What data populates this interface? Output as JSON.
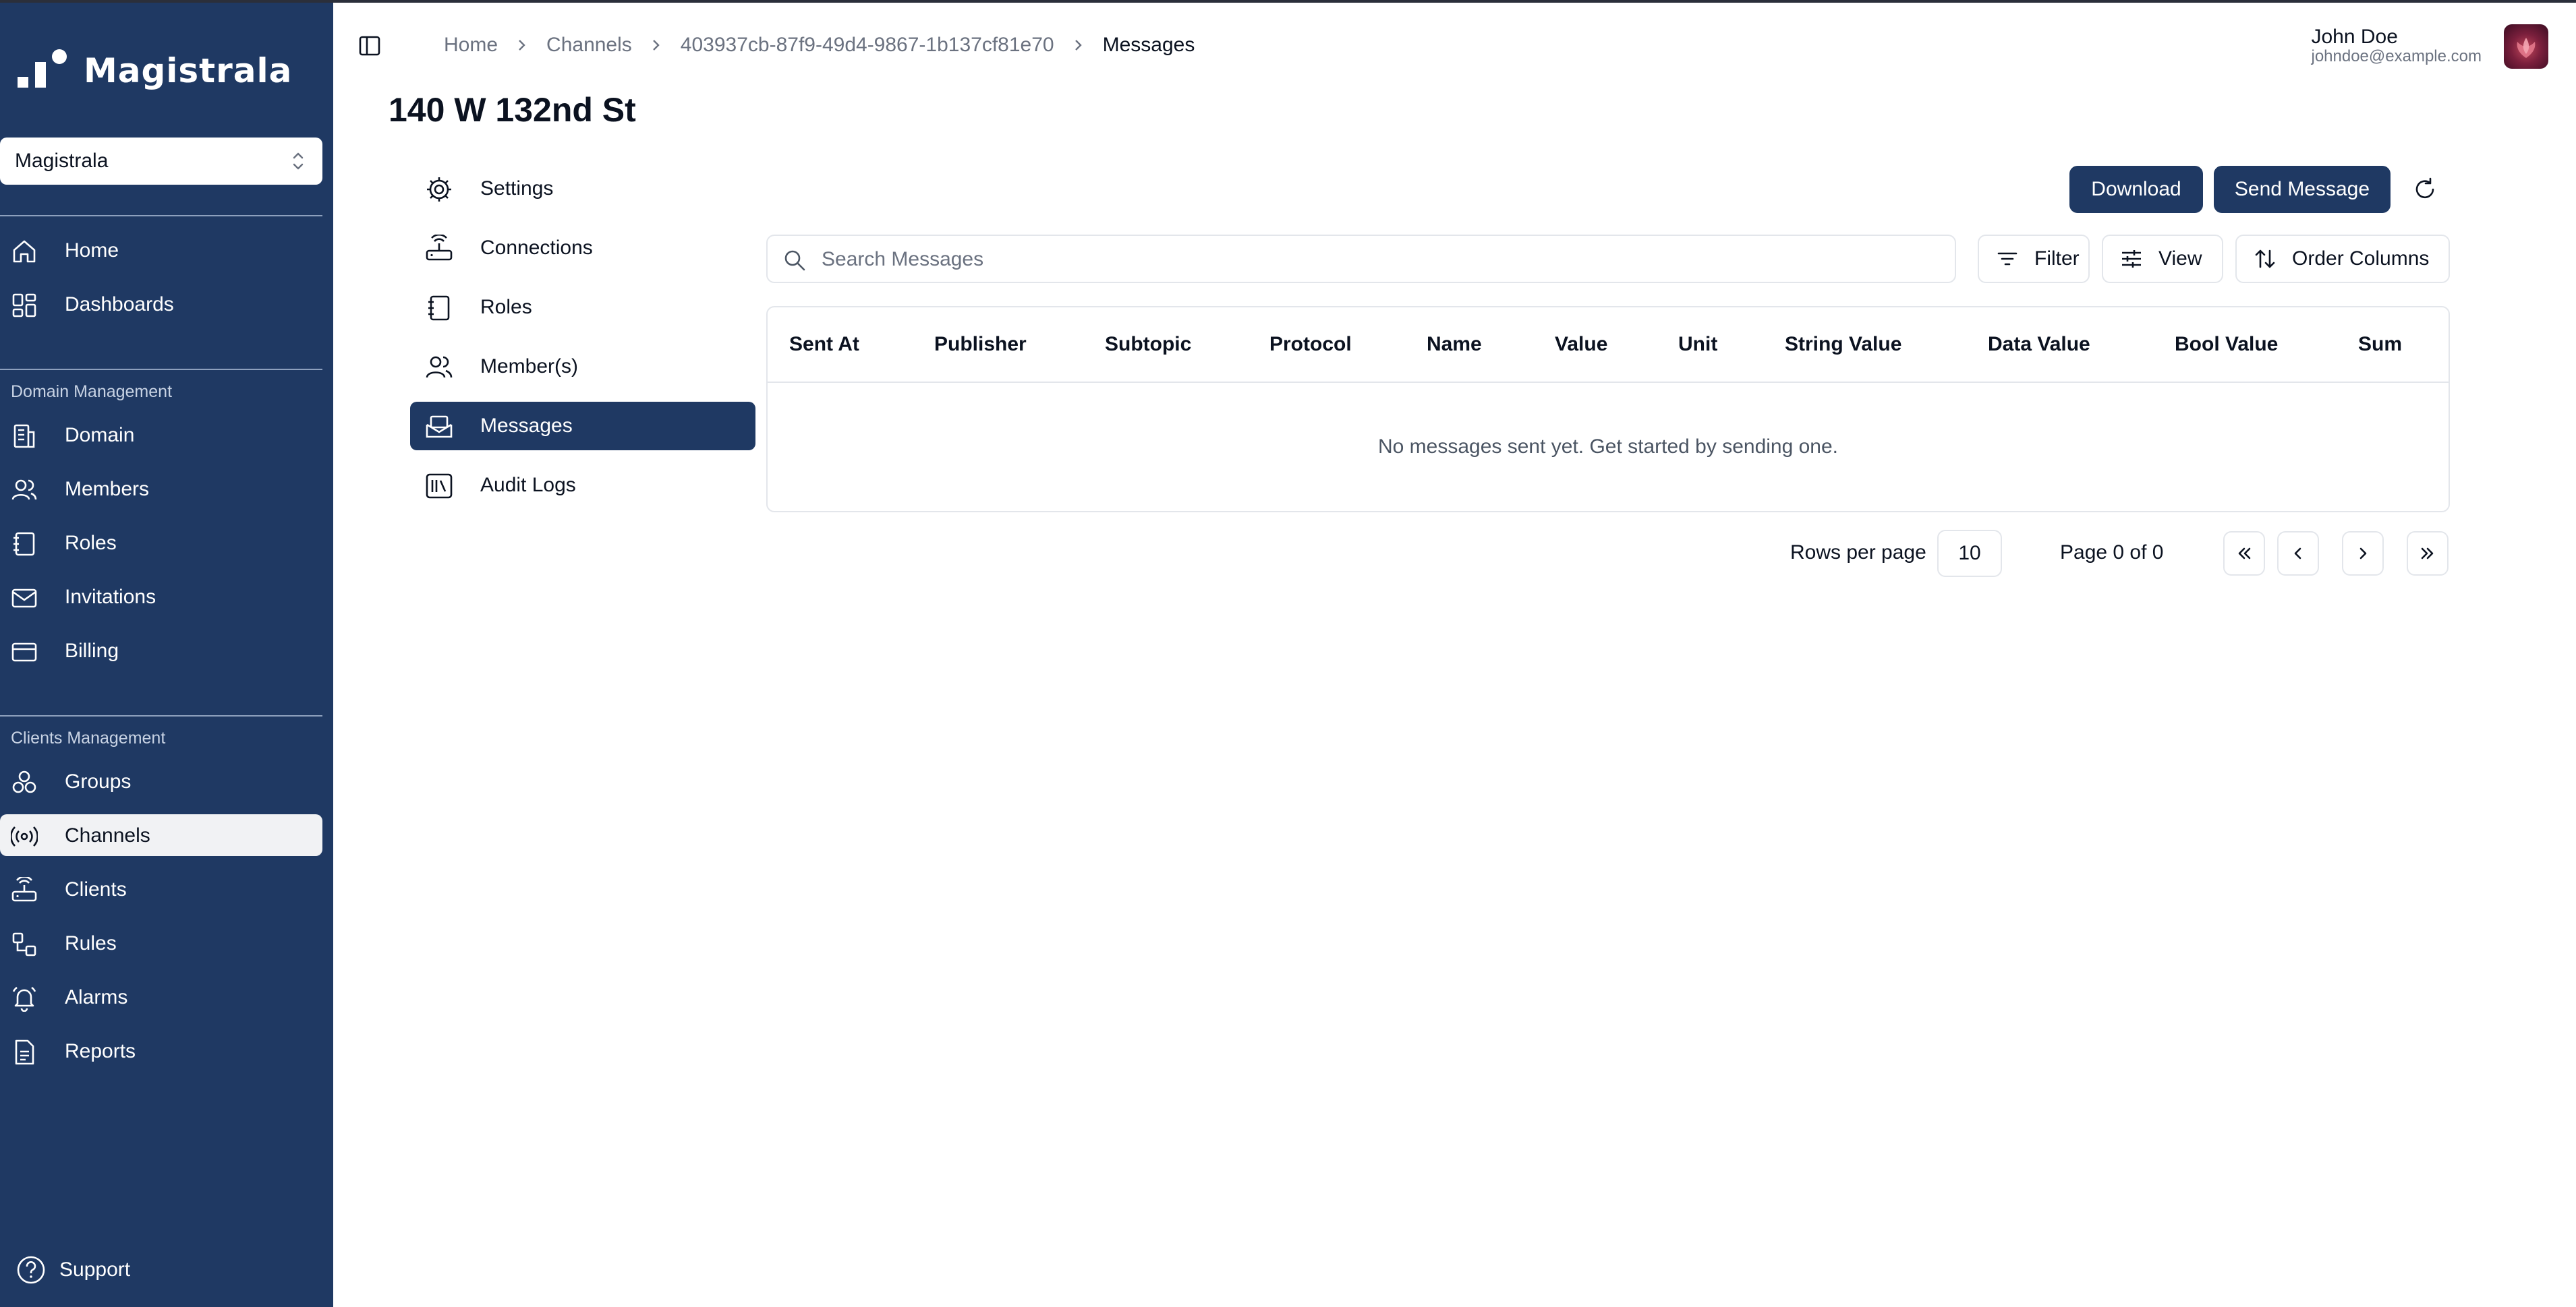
{
  "app": {
    "brand": "Magistrala",
    "domain_selector": "Magistrala"
  },
  "sidebar": {
    "top_items": [
      {
        "label": "Home",
        "icon": "home-icon"
      },
      {
        "label": "Dashboards",
        "icon": "dashboard-icon"
      }
    ],
    "domain_section": "Domain Management",
    "domain_items": [
      {
        "label": "Domain",
        "icon": "domain-icon"
      },
      {
        "label": "Members",
        "icon": "members-icon"
      },
      {
        "label": "Roles",
        "icon": "roles-icon"
      },
      {
        "label": "Invitations",
        "icon": "mail-icon"
      },
      {
        "label": "Billing",
        "icon": "credit-card-icon"
      }
    ],
    "clients_section": "Clients Management",
    "clients_items": [
      {
        "label": "Groups",
        "icon": "groups-icon"
      },
      {
        "label": "Channels",
        "icon": "broadcast-icon",
        "active": true
      },
      {
        "label": "Clients",
        "icon": "router-icon"
      },
      {
        "label": "Rules",
        "icon": "rules-icon"
      },
      {
        "label": "Alarms",
        "icon": "bell-icon"
      },
      {
        "label": "Reports",
        "icon": "report-icon"
      }
    ],
    "support": "Support"
  },
  "header": {
    "breadcrumb": [
      "Home",
      "Channels",
      "403937cb-87f9-49d4-9867-1b137cf81e70",
      "Messages"
    ],
    "user_name": "John Doe",
    "user_email": "johndoe@example.com"
  },
  "page": {
    "title": "140 W 132nd St"
  },
  "channel_nav": [
    {
      "label": "Settings",
      "icon": "gear-icon"
    },
    {
      "label": "Connections",
      "icon": "router-icon"
    },
    {
      "label": "Roles",
      "icon": "roles-icon"
    },
    {
      "label": "Member(s)",
      "icon": "members-icon"
    },
    {
      "label": "Messages",
      "icon": "messages-icon",
      "active": true
    },
    {
      "label": "Audit Logs",
      "icon": "audit-logs-icon"
    }
  ],
  "toolbar": {
    "download": "Download",
    "send_message": "Send Message",
    "search_placeholder": "Search Messages",
    "filter": "Filter",
    "view": "View",
    "order_columns": "Order Columns"
  },
  "table": {
    "columns": [
      "Sent At",
      "Publisher",
      "Subtopic",
      "Protocol",
      "Name",
      "Value",
      "Unit",
      "String Value",
      "Data Value",
      "Bool Value",
      "Sum"
    ],
    "empty_message": "No messages sent yet. Get started by sending one."
  },
  "pagination": {
    "rows_per_page_label": "Rows per page",
    "rows_per_page": "10",
    "page_info": "Page 0 of 0"
  },
  "colors": {
    "sidebar_bg": "#1f3963",
    "primary": "#1f3963",
    "border": "#e3e6eb",
    "muted_text": "#6b7280"
  }
}
